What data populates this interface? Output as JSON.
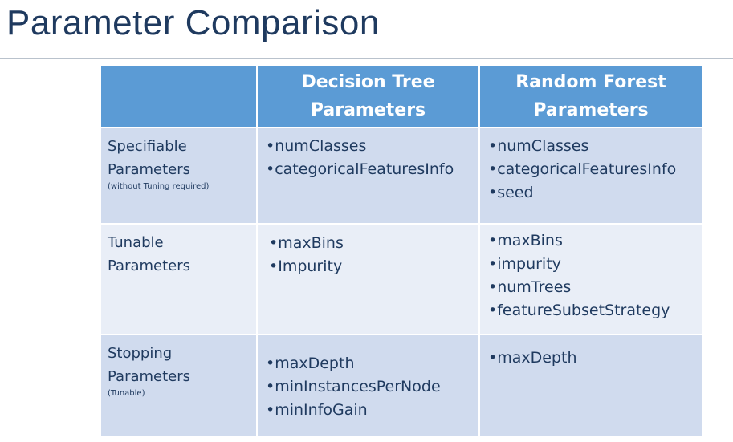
{
  "title": "Parameter Comparison",
  "table": {
    "headers": [
      "",
      "Decision Tree Parameters",
      "Random Forest Parameters"
    ],
    "header_lines": {
      "decision_tree": [
        "Decision Tree",
        "Parameters"
      ],
      "random_forest": [
        "Random Forest",
        "Parameters"
      ]
    },
    "rows": [
      {
        "label_lines": [
          "Specifiable",
          "Parameters"
        ],
        "note": "(without Tuning required)",
        "decision_tree": [
          "numClasses",
          "categoricalFeaturesInfo"
        ],
        "random_forest": [
          "numClasses",
          "categoricalFeaturesInfo",
          "seed"
        ]
      },
      {
        "label_lines": [
          "Tunable",
          "Parameters"
        ],
        "note": "",
        "decision_tree": [
          "maxBins",
          "Impurity"
        ],
        "random_forest": [
          "maxBins",
          "impurity",
          "numTrees",
          "featureSubsetStrategy"
        ]
      },
      {
        "label_lines": [
          "Stopping",
          "Parameters"
        ],
        "note": "(Tunable)",
        "decision_tree": [
          "maxDepth",
          "minInstancesPerNode",
          "minInfoGain"
        ],
        "random_forest": [
          "maxDepth"
        ]
      }
    ]
  },
  "colors": {
    "header_bg": "#5b9bd5",
    "row_dark": "#d0dbee",
    "row_light": "#e9eef7",
    "text": "#1f3a5f"
  }
}
